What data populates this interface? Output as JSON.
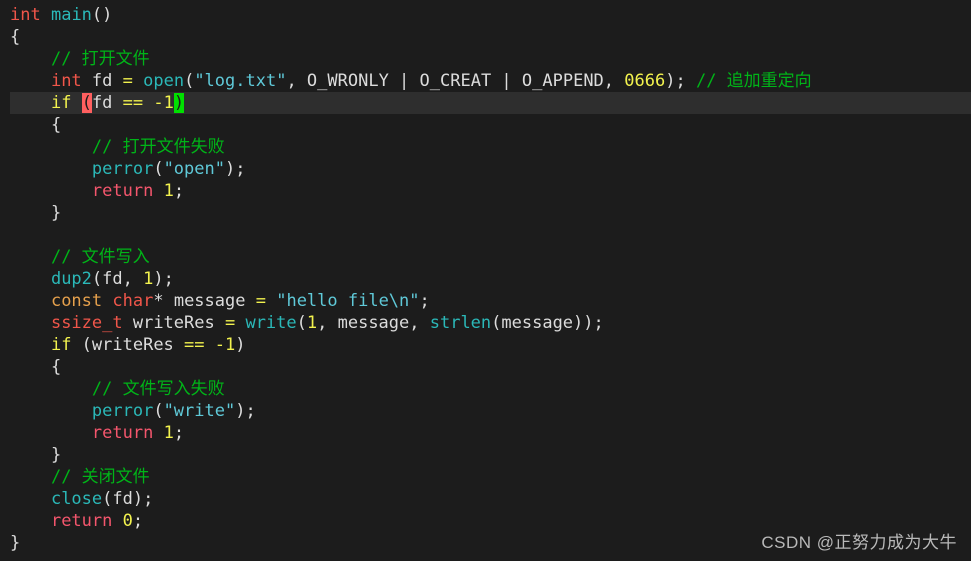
{
  "editor": {
    "background": "#1c1c1c",
    "current_line_background": "#2e2e2e",
    "language": "c",
    "font_size_px": 17,
    "line_height_px": 22
  },
  "colors": {
    "type": "#f0564a",
    "keyword_if": "#f2f24e",
    "keyword_return": "#f4566d",
    "keyword_const": "#e5a04c",
    "function": "#2bb8b8",
    "string": "#5fc9d8",
    "number": "#f2f24e",
    "comment": "#00b418",
    "plain": "#dcdcdc",
    "bracket_open_bg": "#ff5f5f",
    "bracket_close_bg": "#00e000"
  },
  "code": {
    "l1": {
      "type": "int",
      "fn": "main",
      "punct": "()"
    },
    "l2": {
      "brace": "{"
    },
    "l3": {
      "indent": "    ",
      "comment": "// 打开文件"
    },
    "l4": {
      "indent": "    ",
      "type": "int",
      "var": " fd ",
      "op": "=",
      "fn": " open",
      "p1": "(",
      "str": "\"log.txt\"",
      "sep1": ", ",
      "macro1": "O_WRONLY",
      "pipe1": " | ",
      "macro2": "O_CREAT",
      "pipe2": " | ",
      "macro3": "O_APPEND",
      "sep2": ", ",
      "num": "0666",
      "p2": ");",
      "comment": " // 追加重定向"
    },
    "l5": {
      "indent": "    ",
      "kw": "if",
      "space": " ",
      "bracket_open": "(",
      "var": "fd ",
      "op": "==",
      "space2": " ",
      "minus": "-",
      "num": "1",
      "bracket_close": ")"
    },
    "l6": {
      "indent": "    ",
      "brace": "{"
    },
    "l7": {
      "indent": "        ",
      "comment": "// 打开文件失败"
    },
    "l8": {
      "indent": "        ",
      "fn": "perror",
      "p1": "(",
      "str": "\"open\"",
      "p2": ");"
    },
    "l9": {
      "indent": "        ",
      "kw": "return",
      "space": " ",
      "num": "1",
      "punct": ";"
    },
    "l10": {
      "indent": "    ",
      "brace": "}"
    },
    "l11": {
      "blank": ""
    },
    "l12": {
      "indent": "    ",
      "comment": "// 文件写入"
    },
    "l13": {
      "indent": "    ",
      "fn": "dup2",
      "p1": "(",
      "var": "fd, ",
      "num": "1",
      "p2": ");"
    },
    "l14": {
      "indent": "    ",
      "kw_const": "const",
      "space": " ",
      "type": "char",
      "star": "*",
      "var": " message ",
      "op": "=",
      "space2": " ",
      "str": "\"hello file\\n\"",
      "punct": ";"
    },
    "l15": {
      "indent": "    ",
      "type": "ssize_t",
      "var": " writeRes ",
      "op": "=",
      "fn": " write",
      "p1": "(",
      "num": "1",
      "sep": ", message, ",
      "fn2": "strlen",
      "p2": "(message));"
    },
    "l16": {
      "indent": "    ",
      "kw": "if",
      "p1": " (writeRes ",
      "op": "==",
      "space": " ",
      "minus": "-",
      "num": "1",
      "p2": ")"
    },
    "l17": {
      "indent": "    ",
      "brace": "{"
    },
    "l18": {
      "indent": "        ",
      "comment": "// 文件写入失败"
    },
    "l19": {
      "indent": "        ",
      "fn": "perror",
      "p1": "(",
      "str": "\"write\"",
      "p2": ");"
    },
    "l20": {
      "indent": "        ",
      "kw": "return",
      "space": " ",
      "num": "1",
      "punct": ";"
    },
    "l21": {
      "indent": "    ",
      "brace": "}"
    },
    "l22": {
      "indent": "    ",
      "comment": "// 关闭文件"
    },
    "l23": {
      "indent": "    ",
      "fn": "close",
      "p1": "(",
      "var": "fd",
      "p2": ");"
    },
    "l24": {
      "indent": "    ",
      "kw": "return",
      "space": " ",
      "num": "0",
      "punct": ";"
    },
    "l25": {
      "brace": "}"
    }
  },
  "watermark": {
    "text": "CSDN @正努力成为大牛"
  }
}
